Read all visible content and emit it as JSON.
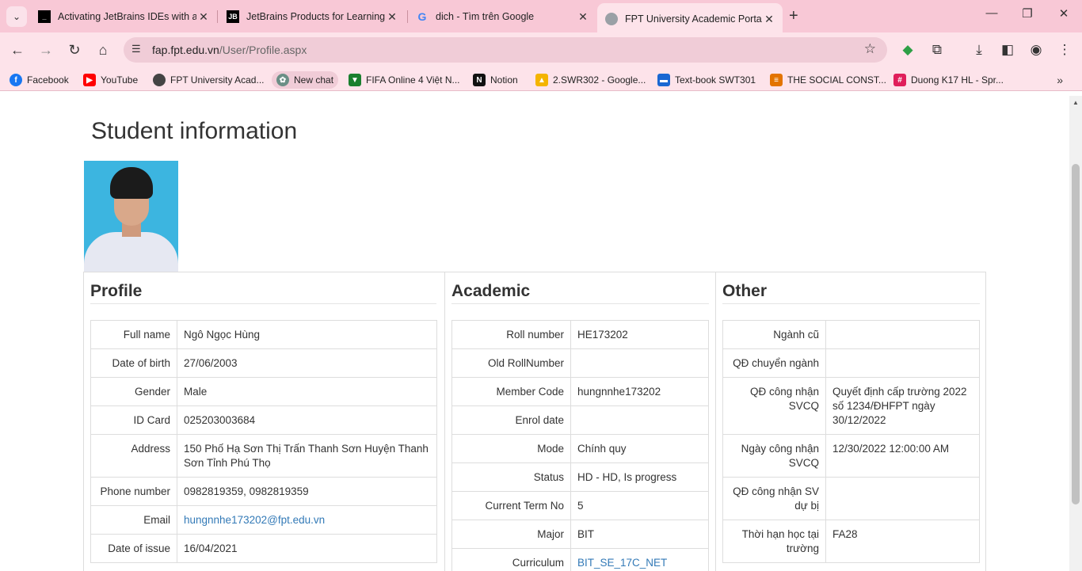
{
  "browser": {
    "tabs": [
      {
        "title": "Activating JetBrains IDEs with an…",
        "icon": "jetbrains-terminal-icon"
      },
      {
        "title": "JetBrains Products for Learning",
        "icon": "jetbrains-icon"
      },
      {
        "title": "dich - Tìm trên Google",
        "icon": "google-icon"
      },
      {
        "title": "FPT University Academic Portal",
        "icon": "globe-icon"
      }
    ],
    "url_host": "fap.fpt.edu.vn",
    "url_path": "/User/Profile.aspx",
    "bookmarks": [
      {
        "label": "Facebook",
        "color": "#1877f2"
      },
      {
        "label": "YouTube",
        "color": "#ff0000"
      },
      {
        "label": "FPT University Acad...",
        "color": "#444444"
      },
      {
        "label": "New chat",
        "color": "#6b8f86"
      },
      {
        "label": "FIFA Online 4 Việt N...",
        "color": "#1a7f2e"
      },
      {
        "label": "Notion",
        "color": "#111111"
      },
      {
        "label": "2.SWR302 - Google...",
        "color": "#f4b400"
      },
      {
        "label": "Text-book SWT301",
        "color": "#1967d2"
      },
      {
        "label": "THE SOCIAL CONST...",
        "color": "#e37400"
      },
      {
        "label": "Duong K17 HL - Spr...",
        "color": "#e01e5a"
      }
    ]
  },
  "page": {
    "title": "Student information",
    "profile": {
      "heading": "Profile",
      "rows": [
        {
          "k": "Full name",
          "v": "Ngô Ngọc Hùng"
        },
        {
          "k": "Date of birth",
          "v": "27/06/2003"
        },
        {
          "k": "Gender",
          "v": "Male"
        },
        {
          "k": "ID Card",
          "v": "025203003684"
        },
        {
          "k": "Address",
          "v": "150 Phố Hạ Sơn Thị Trấn Thanh Sơn Huyện Thanh Sơn Tỉnh Phú Thọ"
        },
        {
          "k": "Phone number",
          "v": "0982819359, 0982819359"
        },
        {
          "k": "Email",
          "v": "hungnnhe173202@fpt.edu.vn"
        },
        {
          "k": "Date of issue",
          "v": "16/04/2021"
        }
      ]
    },
    "academic": {
      "heading": "Academic",
      "rows": [
        {
          "k": "Roll number",
          "v": "HE173202"
        },
        {
          "k": "Old RollNumber",
          "v": ""
        },
        {
          "k": "Member Code",
          "v": "hungnnhe173202"
        },
        {
          "k": "Enrol date",
          "v": ""
        },
        {
          "k": "Mode",
          "v": "Chính quy"
        },
        {
          "k": "Status",
          "v": "HD - HD, Is progress"
        },
        {
          "k": "Current Term No",
          "v": "5"
        },
        {
          "k": "Major",
          "v": "BIT"
        },
        {
          "k": "Curriculum",
          "v": "BIT_SE_17C_NET"
        }
      ]
    },
    "other": {
      "heading": "Other",
      "rows": [
        {
          "k": "Ngành cũ",
          "v": ""
        },
        {
          "k": "QĐ chuyển ngành",
          "v": ""
        },
        {
          "k": "QĐ công nhận SVCQ",
          "v": "Quyết định cấp trường 2022 số 1234/ĐHFPT ngày 30/12/2022"
        },
        {
          "k": "Ngày công nhận SVCQ",
          "v": "12/30/2022 12:00:00 AM"
        },
        {
          "k": "QĐ công nhận SV dự bị",
          "v": ""
        },
        {
          "k": "Thời hạn học tại trường",
          "v": "FA28"
        }
      ]
    },
    "link_color": "#337ab7"
  }
}
